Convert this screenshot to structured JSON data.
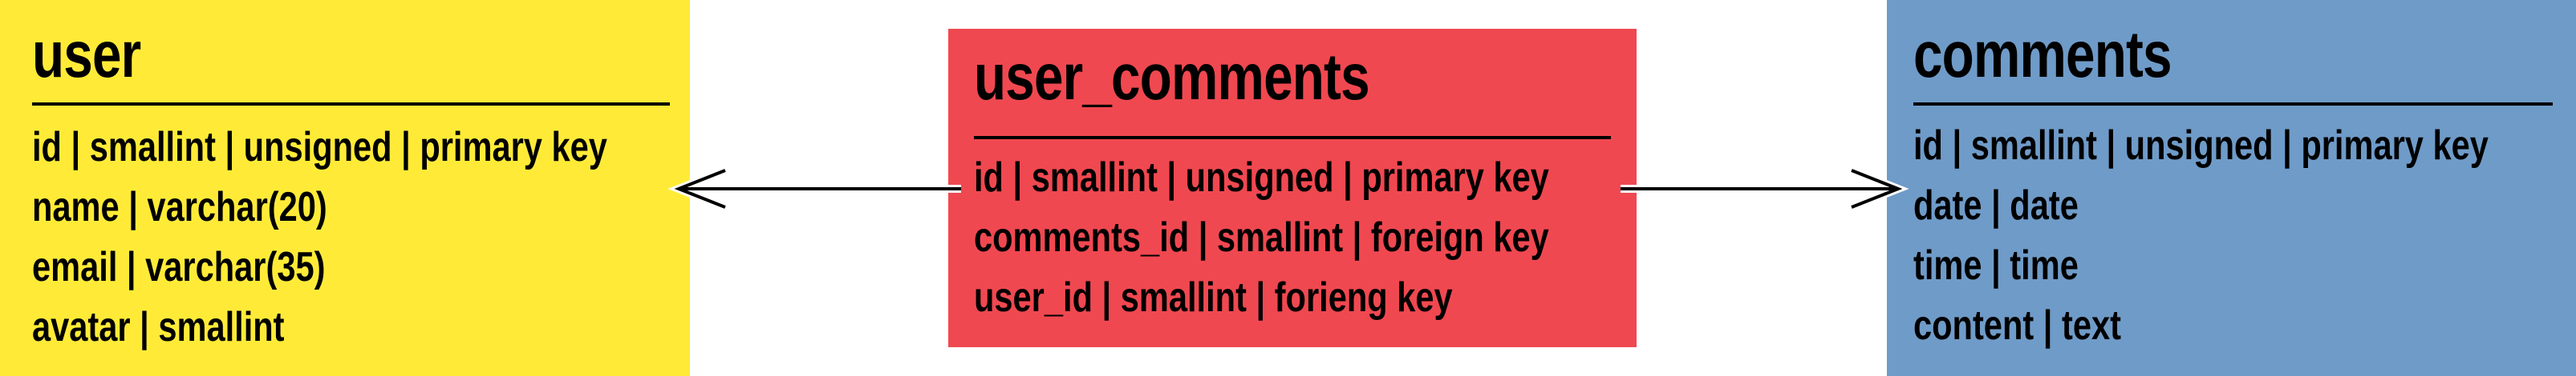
{
  "entities": {
    "user": {
      "title": "user",
      "color": "#ffeb37",
      "fields": [
        "id | smallint | unsigned | primary key",
        "name | varchar(20)",
        "email | varchar(35)",
        "avatar | smallint"
      ]
    },
    "user_comments": {
      "title": "user_comments",
      "color": "#f04850",
      "fields": [
        "id | smallint | unsigned | primary key",
        "comments_id | smallint | foreign key",
        "user_id | smallint | forieng key"
      ]
    },
    "comments": {
      "title": "comments",
      "color": "#6f9bc8",
      "fields": [
        "id | smallint | unsigned | primary key",
        "date | date",
        "time | time",
        "content | text"
      ]
    }
  },
  "relationships": [
    {
      "from": "user",
      "to": "user_comments",
      "notation": "crows-foot-many-at-user"
    },
    {
      "from": "user_comments",
      "to": "comments",
      "notation": "crows-foot-many-at-comments"
    }
  ]
}
